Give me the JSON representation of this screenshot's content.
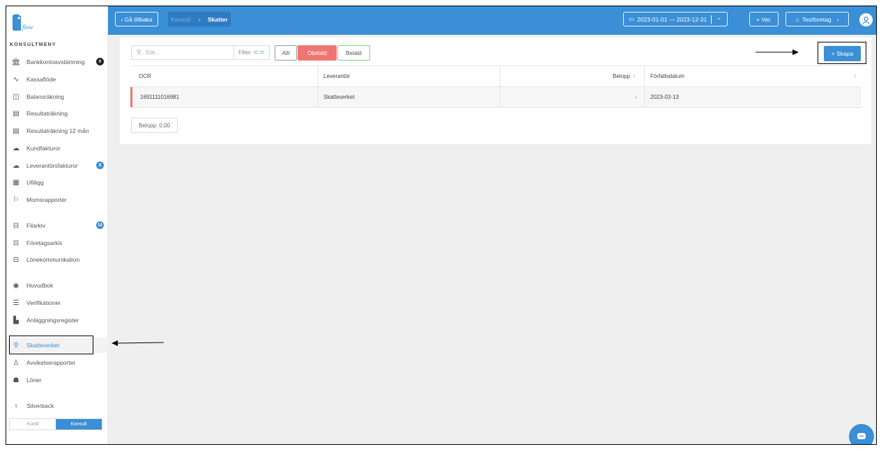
{
  "sidebar": {
    "heading": "KONSULTMENY",
    "items": [
      {
        "label": "Bankkontoavstämning",
        "badge": "0"
      },
      {
        "label": "Kassaflöde"
      },
      {
        "label": "Balansräkning"
      },
      {
        "label": "Resultaträkning"
      },
      {
        "label": "Resultaträkning 12 mån"
      },
      {
        "label": "Kundfakturor"
      },
      {
        "label": "Leverantörsfakturor",
        "badge": "8"
      },
      {
        "label": "Utlägg"
      },
      {
        "label": "Momsrapporter"
      },
      {
        "label": "Filarkiv",
        "badge": "10"
      },
      {
        "label": "Företagsarkiv"
      },
      {
        "label": "Lönekommunikation"
      },
      {
        "label": "Huvudbok"
      },
      {
        "label": "Verifikationer"
      },
      {
        "label": "Anläggningsregister"
      },
      {
        "label": "Skatteverket"
      },
      {
        "label": "Avvikelserapporter"
      },
      {
        "label": "Löner"
      },
      {
        "label": "Silverback"
      }
    ],
    "toggle": {
      "off": "Kund",
      "on": "Konsult"
    }
  },
  "topbar": {
    "back_label": "‹  Gå tillbaka",
    "breadcrumb": [
      "Konsult",
      "Skatter"
    ],
    "date_range": "2023-01-01 — 2023-12-31",
    "ver_label": "+ Ver.",
    "company_label": "Testforetag"
  },
  "toolbar": {
    "search_placeholder": "Sök...",
    "filter_label": "Filter",
    "chips": [
      "Allt",
      "Obetald",
      "Betald"
    ],
    "create_label": "+ Skapa"
  },
  "table": {
    "columns": [
      "OCR",
      "Leverantör",
      "Belopp",
      "Förfallodatum"
    ],
    "rows": [
      {
        "ocr": "1691111016981",
        "supplier": "Skatteverket",
        "amount": "-",
        "due": "2023-03-13"
      }
    ]
  },
  "summary": "Belopp: 0,00",
  "colors": {
    "accent": "#3a8fd6",
    "unpaid": "#f07572",
    "paid": "#7fd27f"
  }
}
